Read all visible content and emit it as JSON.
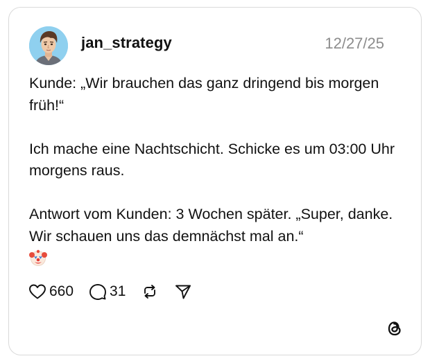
{
  "post": {
    "username": "jan_strategy",
    "timestamp": "12/27/25",
    "paragraphs": [
      "Kunde: „Wir brauchen das ganz dringend bis morgen früh!“",
      "Ich mache eine Nachtschicht. Schicke es um 03:00 Uhr morgens raus.",
      "Antwort vom Kunden: 3 Wochen später. „Super, danke. Wir schauen uns das demnächst mal an.“"
    ],
    "emoji": "clown-face"
  },
  "actions": {
    "likes": "660",
    "replies": "31"
  },
  "icons": {
    "like": "heart-icon",
    "reply": "comment-bubble-icon",
    "repost": "repost-icon",
    "share": "send-icon",
    "brand": "threads-logo-icon"
  }
}
